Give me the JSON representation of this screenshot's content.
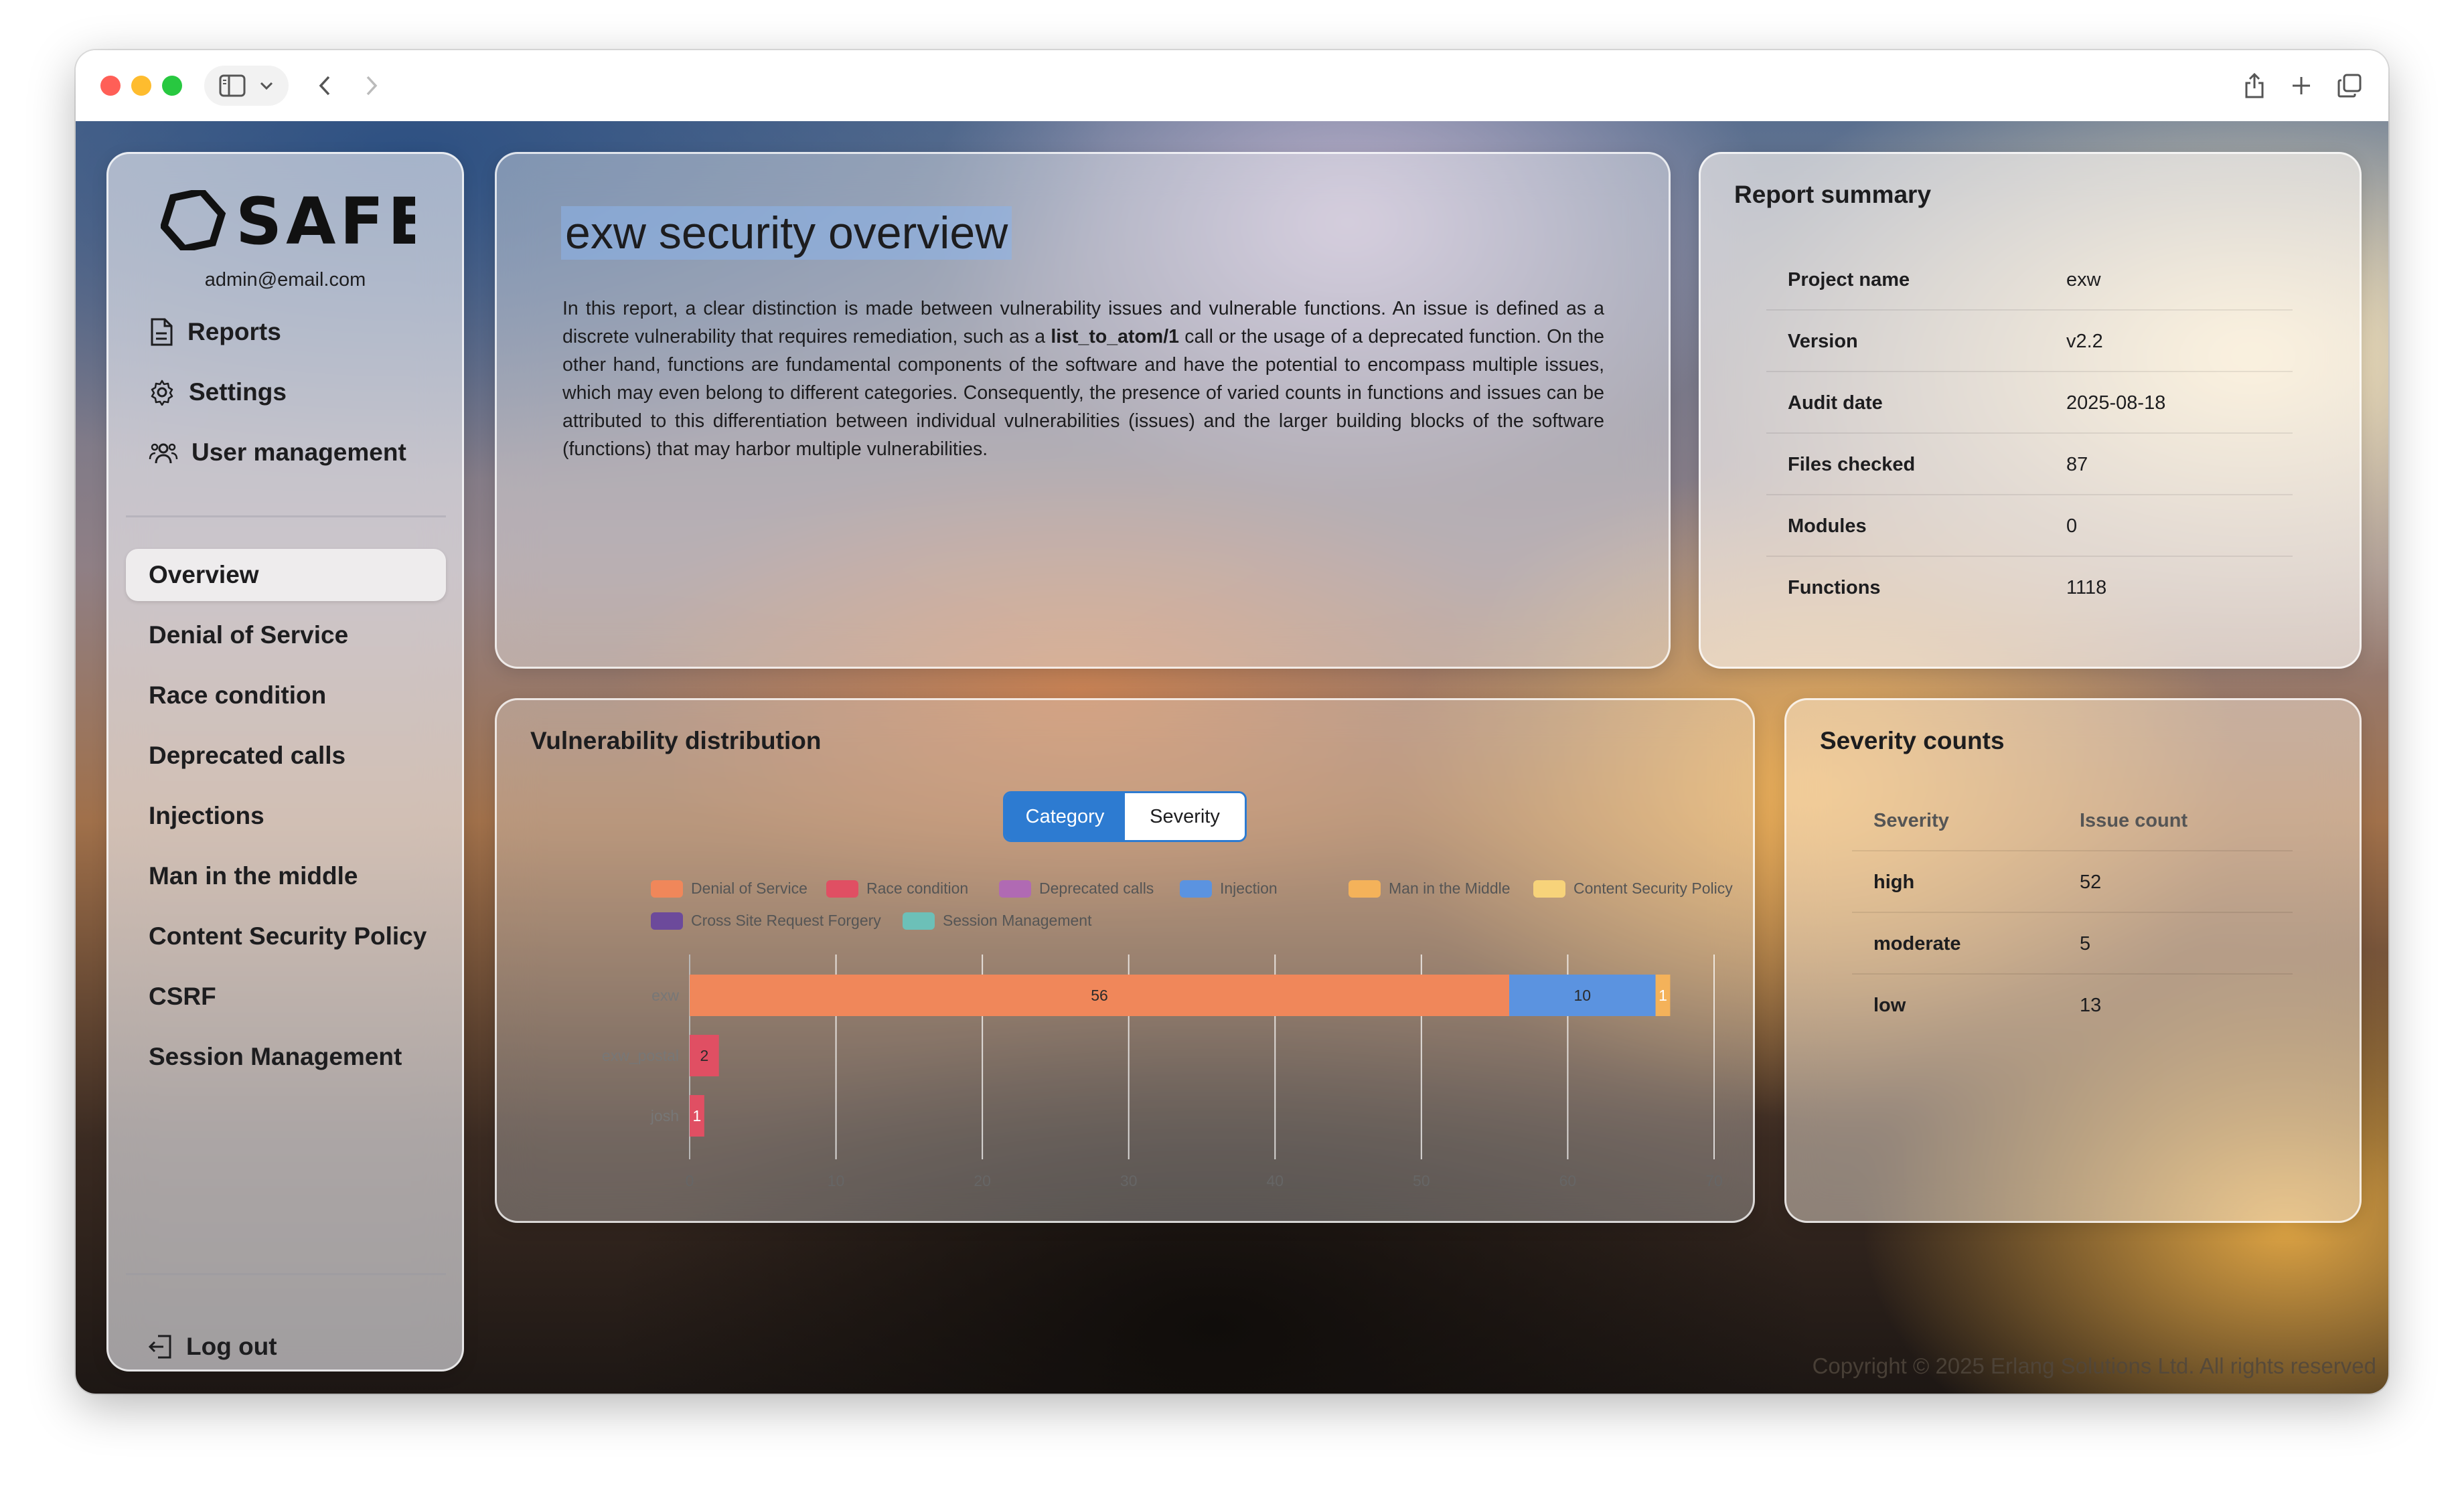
{
  "sidebar": {
    "logo_text": "SAFE",
    "email": "admin@email.com",
    "nav": [
      {
        "label": "Reports",
        "icon": "document-icon"
      },
      {
        "label": "Settings",
        "icon": "gear-icon"
      },
      {
        "label": "User management",
        "icon": "users-icon"
      }
    ],
    "categories": [
      {
        "label": "Overview",
        "active": true
      },
      {
        "label": "Denial of Service"
      },
      {
        "label": "Race condition"
      },
      {
        "label": "Deprecated calls"
      },
      {
        "label": "Injections"
      },
      {
        "label": "Man in the middle"
      },
      {
        "label": "Content Security Policy"
      },
      {
        "label": "CSRF"
      },
      {
        "label": "Session Management"
      }
    ],
    "logout_label": "Log out"
  },
  "overview": {
    "title": "exw security overview",
    "desc_part1": "In this report, a clear distinction is made between vulnerability issues and vulnerable functions. An issue is defined as a discrete vulnerability that requires remediation, such as a ",
    "desc_code": "list_to_atom/1",
    "desc_part2": " call or the usage of a deprecated function. On the other hand, functions are fundamental components of the software and have the potential to encompass multiple issues, which may even belong to different categories. Consequently, the presence of varied counts in functions and issues can be attributed to this differentiation between individual vulnerabilities (issues) and the larger building blocks of the software (functions) that may harbor multiple vulnerabilities."
  },
  "summary": {
    "title": "Report summary",
    "rows": [
      {
        "key": "Project name",
        "value": "exw"
      },
      {
        "key": "Version",
        "value": "v2.2"
      },
      {
        "key": "Audit date",
        "value": "2025-08-18"
      },
      {
        "key": "Files checked",
        "value": "87"
      },
      {
        "key": "Modules",
        "value": "0"
      },
      {
        "key": "Functions",
        "value": "1118"
      }
    ]
  },
  "vuln": {
    "title": "Vulnerability distribution",
    "toggle": {
      "category": "Category",
      "severity": "Severity",
      "selected": "category"
    }
  },
  "chart_data": {
    "type": "bar",
    "orientation": "horizontal",
    "stacked": true,
    "categories": [
      "exw",
      "exw_postal",
      "josh"
    ],
    "series": [
      {
        "name": "Denial of Service",
        "color": "#f0875a",
        "values": [
          56,
          0,
          0
        ]
      },
      {
        "name": "Race condition",
        "color": "#e04f63",
        "values": [
          0,
          2,
          1
        ]
      },
      {
        "name": "Deprecated calls",
        "color": "#b06ab3",
        "values": [
          0,
          0,
          0
        ]
      },
      {
        "name": "Injection",
        "color": "#5b93e0",
        "values": [
          10,
          0,
          0
        ]
      },
      {
        "name": "Man in the Middle",
        "color": "#f4b25a",
        "values": [
          1,
          0,
          0
        ]
      },
      {
        "name": "Content Security Policy",
        "color": "#f7d37a",
        "values": [
          0,
          0,
          0
        ]
      },
      {
        "name": "Cross Site Request Forgery",
        "color": "#6c4a9b",
        "values": [
          0,
          0,
          0
        ]
      },
      {
        "name": "Session Management",
        "color": "#6cc0b8",
        "values": [
          0,
          0,
          0
        ]
      }
    ],
    "xlim": [
      0,
      70
    ],
    "xticks": [
      0,
      10,
      20,
      30,
      40,
      50,
      60,
      70
    ],
    "grid": true,
    "legend": "top"
  },
  "severity": {
    "title": "Severity counts",
    "header": {
      "severity": "Severity",
      "count": "Issue count"
    },
    "rows": [
      {
        "severity": "high",
        "count": "52"
      },
      {
        "severity": "moderate",
        "count": "5"
      },
      {
        "severity": "low",
        "count": "13"
      }
    ]
  },
  "footer": "Copyright © 2025 Erlang Solutions Ltd. All rights reserved"
}
